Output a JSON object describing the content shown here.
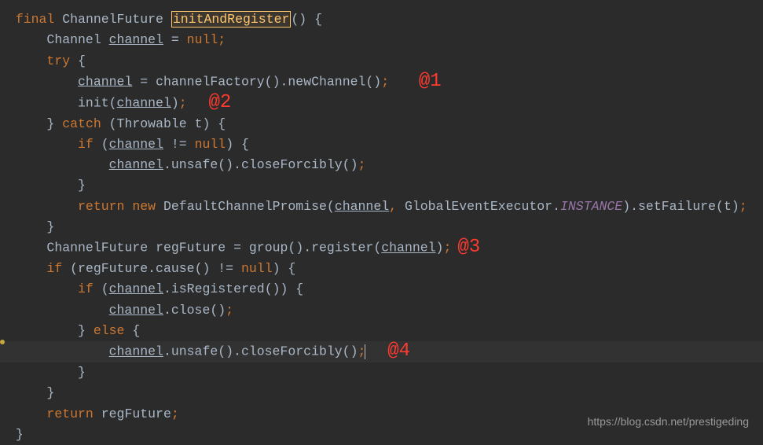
{
  "code": {
    "kw_final": "final",
    "type_channelfuture": "ChannelFuture",
    "method_initandregister": "initAndRegister",
    "paren_empty": "()",
    "brace_open": "{",
    "brace_close": "}",
    "type_channel": "Channel",
    "var_channel": "channel",
    "eq": " = ",
    "kw_null": "null",
    "semi": ";",
    "kw_try": "try",
    "call_channelfactory": "channelFactory().newChannel()",
    "call_init": "init(",
    "close_paren": ")",
    "kw_catch": "catch",
    "catch_sig": "(Throwable t) {",
    "kw_if": "if",
    "cond_neq_null": " != ",
    "call_unsafe_close": ".unsafe().closeForcibly()",
    "kw_return": "return",
    "kw_new": "new",
    "type_dcp": "DefaultChannelPromise(",
    "comma_space": ", ",
    "type_gee": "GlobalEventExecutor.",
    "const_instance": "INSTANCE",
    "tail_setfailure": ").setFailure(t)",
    "var_regfuture": "regFuture",
    "call_group_register": "group().register(",
    "cond_regfuture_cause": "(regFuture.cause() != ",
    "call_isregistered": ".isRegistered()) {",
    "call_close": ".close()",
    "kw_else": "else"
  },
  "annotations": {
    "a1": "@1",
    "a2": "@2",
    "a3": "@3",
    "a4": "@4"
  },
  "watermark": "https://blog.csdn.net/prestigeding"
}
